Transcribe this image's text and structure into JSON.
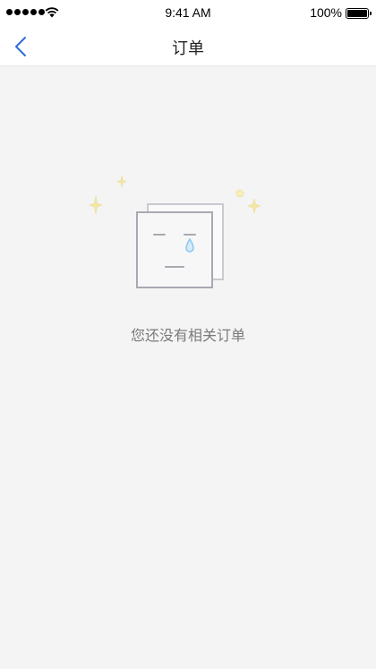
{
  "status_bar": {
    "time": "9:41 AM",
    "battery_percent": "100%",
    "signal_bars": 5,
    "icons": [
      "signal-dots-icon",
      "wifi-icon",
      "battery-icon"
    ]
  },
  "nav": {
    "title": "订单",
    "back_icon": "chevron-left-icon",
    "accent_color": "#2d6fd6"
  },
  "empty_state": {
    "message": "您还没有相关订单",
    "icons": [
      "sad-document-icon",
      "sparkle-icon",
      "tear-drop-icon"
    ],
    "colors": {
      "outline": "#a9a9b3",
      "sparkle": "#f3e7a6",
      "tear": "#8bc6ee"
    }
  },
  "colors": {
    "background": "#f4f4f4",
    "bar_background": "#ffffff",
    "text_muted": "#7a7a7a"
  }
}
